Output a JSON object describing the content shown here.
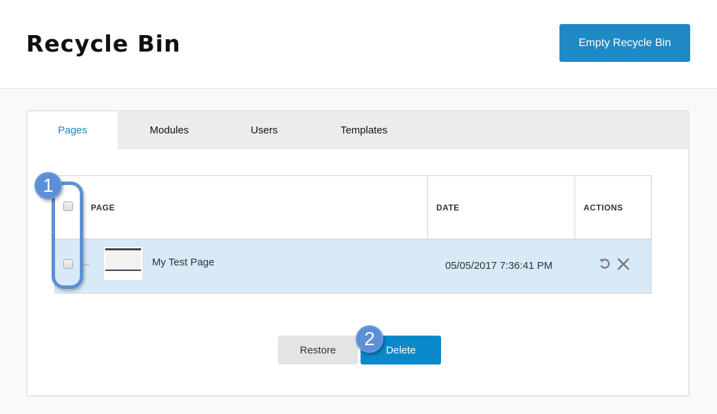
{
  "header": {
    "title": "Recycle Bin",
    "empty_button": "Empty Recycle Bin"
  },
  "tabs": [
    {
      "label": "Pages",
      "active": true
    },
    {
      "label": "Modules",
      "active": false
    },
    {
      "label": "Users",
      "active": false
    },
    {
      "label": "Templates",
      "active": false
    }
  ],
  "table": {
    "columns": [
      "PAGE",
      "DATE",
      "ACTIONS"
    ],
    "rows": [
      {
        "page": "My Test Page",
        "date": "05/05/2017 7:36:41 PM",
        "actions": [
          "restore-icon",
          "delete-icon"
        ],
        "selected": false
      }
    ]
  },
  "buttons": {
    "restore": "Restore",
    "delete": "Delete"
  },
  "callouts": [
    "1",
    "2"
  ],
  "colors": {
    "accent": "#1f89c3",
    "delete_button": "#0a88c9",
    "row_highlight": "#d8e9f7",
    "callout": "#5b8fd6"
  }
}
